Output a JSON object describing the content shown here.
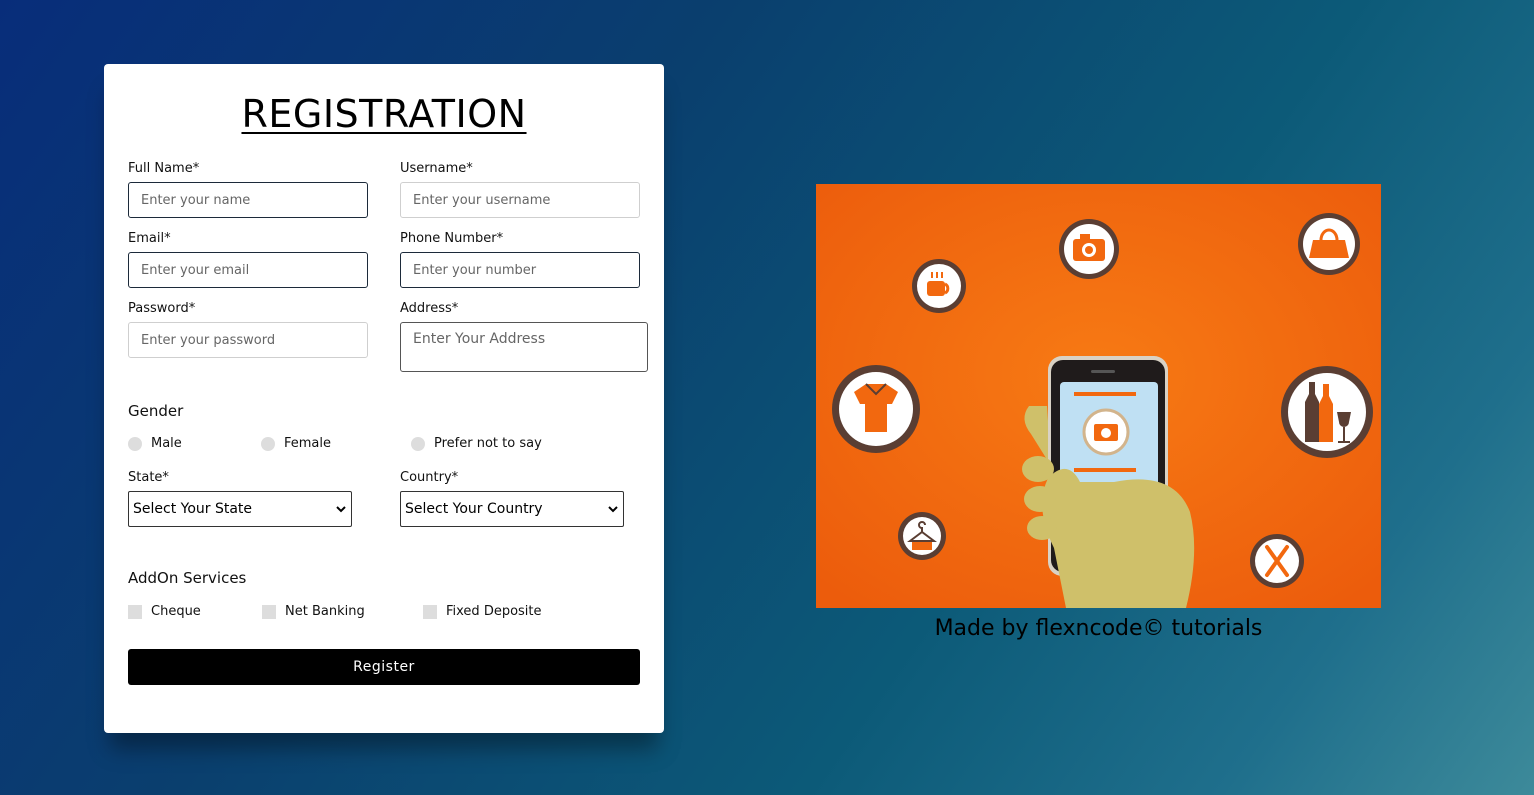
{
  "form": {
    "title": "REGISTRATION",
    "full_name": {
      "label": "Full Name*",
      "placeholder": "Enter your name"
    },
    "username": {
      "label": "Username*",
      "placeholder": "Enter your username"
    },
    "email": {
      "label": "Email*",
      "placeholder": "Enter your email"
    },
    "phone": {
      "label": "Phone Number*",
      "placeholder": "Enter your number"
    },
    "password": {
      "label": "Password*",
      "placeholder": "Enter your password"
    },
    "address": {
      "label": "Address*",
      "placeholder": "Enter Your Address"
    },
    "gender": {
      "heading": "Gender",
      "options": [
        "Male",
        "Female",
        "Prefer not to say"
      ]
    },
    "state": {
      "label": "State*",
      "selected": "Select Your State"
    },
    "country": {
      "label": "Country*",
      "selected": "Select Your Country"
    },
    "addons": {
      "heading": "AddOn Services",
      "options": [
        "Cheque",
        "Net Banking",
        "Fixed Deposite"
      ]
    },
    "register_label": "Register"
  },
  "side": {
    "credit": "Made by flexncode© tutorials"
  },
  "colors": {
    "illustration_bg": "#f2680f",
    "button_bg": "#000000"
  },
  "icons": [
    "coffee-cup-icon",
    "camera-icon",
    "handbag-icon",
    "shirt-icon",
    "wine-bottles-icon",
    "hanger-icon",
    "fork-knife-icon",
    "smartphone-icon"
  ]
}
